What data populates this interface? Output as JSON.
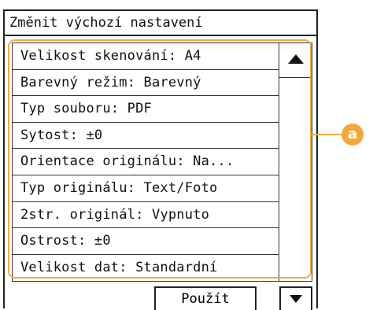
{
  "header": {
    "title": "Změnit výchozí nastavení"
  },
  "settings": [
    {
      "label": "Velikost skenování: A4"
    },
    {
      "label": "Barevný režim: Barevný"
    },
    {
      "label": "Typ souboru: PDF"
    },
    {
      "label": "Sytost: ±0"
    },
    {
      "label": "Orientace originálu: Na..."
    },
    {
      "label": "Typ originálu: Text/Foto"
    },
    {
      "label": "2str. originál: Vypnuto"
    },
    {
      "label": "Ostrost: ±0"
    },
    {
      "label": "Velikost dat: Standardní"
    }
  ],
  "footer": {
    "apply_label": "Použít"
  },
  "callout": {
    "letter": "a",
    "color": "#f2a93b"
  },
  "icons": {
    "scroll_up": "triangle-up-icon",
    "scroll_down": "triangle-down-icon"
  }
}
